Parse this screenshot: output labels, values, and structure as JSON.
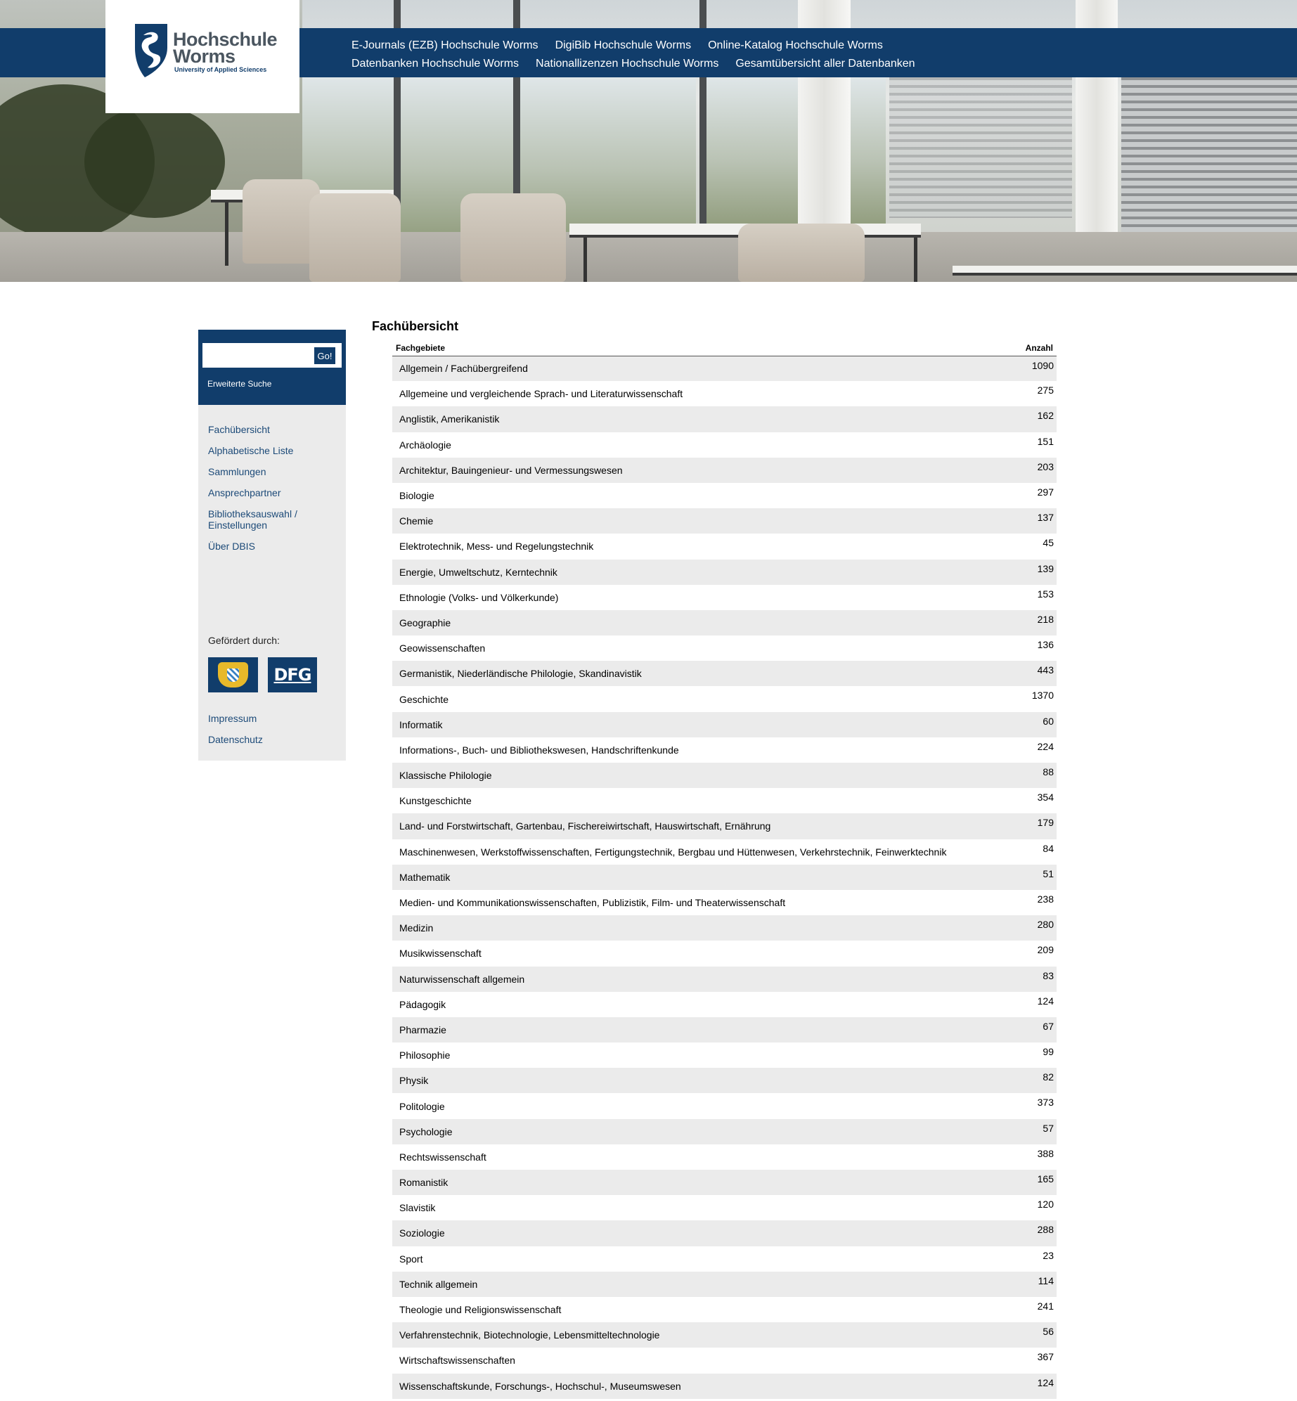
{
  "header": {
    "logo": {
      "line1": "Hochschule",
      "line2": "Worms",
      "subtitle": "University of Applied Sciences"
    },
    "nav_row1": [
      "E-Journals (EZB) Hochschule Worms",
      "DigiBib Hochschule Worms",
      "Online-Katalog Hochschule Worms"
    ],
    "nav_row2": [
      "Datenbanken Hochschule Worms",
      "Nationallizenzen Hochschule Worms",
      "Gesamtübersicht aller Datenbanken"
    ]
  },
  "sidebar": {
    "search": {
      "value": "",
      "button": "Go!",
      "advanced": "Erweiterte Suche"
    },
    "nav": [
      "Fachübersicht",
      "Alphabetische Liste",
      "Sammlungen",
      "Ansprechpartner",
      "Bibliotheksauswahl / Einstellungen",
      "Über DBIS"
    ],
    "funded_label": "Gefördert durch:",
    "funders": [
      "bavaria-crest-icon",
      "DFG"
    ],
    "footer": [
      "Impressum",
      "Datenschutz"
    ]
  },
  "main": {
    "title": "Fachübersicht",
    "columns": {
      "subject": "Fachgebiete",
      "count": "Anzahl"
    },
    "rows": [
      {
        "name": "Allgemein / Fachübergreifend",
        "count": "1090"
      },
      {
        "name": "Allgemeine und vergleichende Sprach- und Literaturwissenschaft",
        "count": "275"
      },
      {
        "name": "Anglistik, Amerikanistik",
        "count": "162"
      },
      {
        "name": "Archäologie",
        "count": "151"
      },
      {
        "name": "Architektur, Bauingenieur- und Vermessungswesen",
        "count": "203"
      },
      {
        "name": "Biologie",
        "count": "297"
      },
      {
        "name": "Chemie",
        "count": "137"
      },
      {
        "name": "Elektrotechnik, Mess- und Regelungstechnik",
        "count": "45"
      },
      {
        "name": "Energie, Umweltschutz, Kerntechnik",
        "count": "139"
      },
      {
        "name": "Ethnologie (Volks- und Völkerkunde)",
        "count": "153"
      },
      {
        "name": "Geographie",
        "count": "218"
      },
      {
        "name": "Geowissenschaften",
        "count": "136"
      },
      {
        "name": "Germanistik, Niederländische Philologie, Skandinavistik",
        "count": "443"
      },
      {
        "name": "Geschichte",
        "count": "1370"
      },
      {
        "name": "Informatik",
        "count": "60"
      },
      {
        "name": "Informations-, Buch- und Bibliothekswesen, Handschriftenkunde",
        "count": "224"
      },
      {
        "name": "Klassische Philologie",
        "count": "88"
      },
      {
        "name": "Kunstgeschichte",
        "count": "354"
      },
      {
        "name": "Land- und Forstwirtschaft, Gartenbau, Fischereiwirtschaft, Hauswirtschaft, Ernährung",
        "count": "179"
      },
      {
        "name": "Maschinenwesen, Werkstoffwissenschaften, Fertigungstechnik, Bergbau und Hüttenwesen, Verkehrstechnik, Feinwerktechnik",
        "count": "84"
      },
      {
        "name": "Mathematik",
        "count": "51"
      },
      {
        "name": "Medien- und Kommunikationswissenschaften, Publizistik, Film- und Theaterwissenschaft",
        "count": "238"
      },
      {
        "name": "Medizin",
        "count": "280"
      },
      {
        "name": "Musikwissenschaft",
        "count": "209"
      },
      {
        "name": "Naturwissenschaft allgemein",
        "count": "83"
      },
      {
        "name": "Pädagogik",
        "count": "124"
      },
      {
        "name": "Pharmazie",
        "count": "67"
      },
      {
        "name": "Philosophie",
        "count": "99"
      },
      {
        "name": "Physik",
        "count": "82"
      },
      {
        "name": "Politologie",
        "count": "373"
      },
      {
        "name": "Psychologie",
        "count": "57"
      },
      {
        "name": "Rechtswissenschaft",
        "count": "388"
      },
      {
        "name": "Romanistik",
        "count": "165"
      },
      {
        "name": "Slavistik",
        "count": "120"
      },
      {
        "name": "Soziologie",
        "count": "288"
      },
      {
        "name": "Sport",
        "count": "23"
      },
      {
        "name": "Technik allgemein",
        "count": "114"
      },
      {
        "name": "Theologie und Religionswissenschaft",
        "count": "241"
      },
      {
        "name": "Verfahrenstechnik, Biotechnologie, Lebensmitteltechnologie",
        "count": "56"
      },
      {
        "name": "Wirtschaftswissenschaften",
        "count": "367"
      },
      {
        "name": "Wissenschaftskunde, Forschungs-, Hochschul-, Museumswesen",
        "count": "124"
      }
    ]
  },
  "colors": {
    "navy": "#113d6b",
    "link": "#1c4a78",
    "stripe": "#ebebeb"
  }
}
